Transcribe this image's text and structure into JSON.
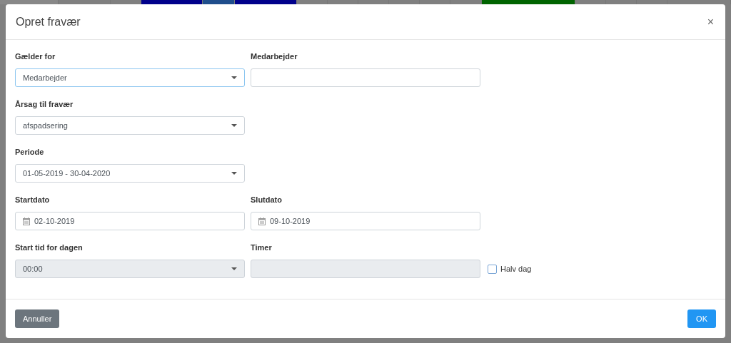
{
  "dialog": {
    "title": "Opret fravær",
    "close": "×"
  },
  "rows": [
    [
      {
        "kind": "select",
        "label": "Gælder for",
        "value": "Medarbejder",
        "focused": true,
        "disabled": false
      },
      {
        "kind": "input",
        "label": "Medarbejder",
        "focused": false,
        "disabled": false
      }
    ],
    [
      {
        "kind": "select",
        "label": "Årsag til fravær",
        "value": "afspadsering",
        "focused": false,
        "disabled": false
      }
    ],
    [
      {
        "kind": "select",
        "label": "Periode",
        "value": "01-05-2019 - 30-04-2020",
        "focused": false,
        "disabled": false
      }
    ],
    [
      {
        "kind": "date",
        "label": "Startdato",
        "value": "02-10-2019",
        "focused": false,
        "disabled": false
      },
      {
        "kind": "date",
        "label": "Slutdato",
        "value": "09-10-2019",
        "focused": false,
        "disabled": false
      }
    ],
    [
      {
        "kind": "select",
        "label": "Start tid for dagen",
        "value": "00:00",
        "focused": false,
        "disabled": true
      },
      {
        "kind": "input",
        "label": "Timer",
        "focused": false,
        "disabled": true
      },
      {
        "kind": "checkbox",
        "label": "Halv dag",
        "checked": false
      }
    ]
  ],
  "footer": {
    "cancel": "Annuller",
    "ok": "OK"
  }
}
